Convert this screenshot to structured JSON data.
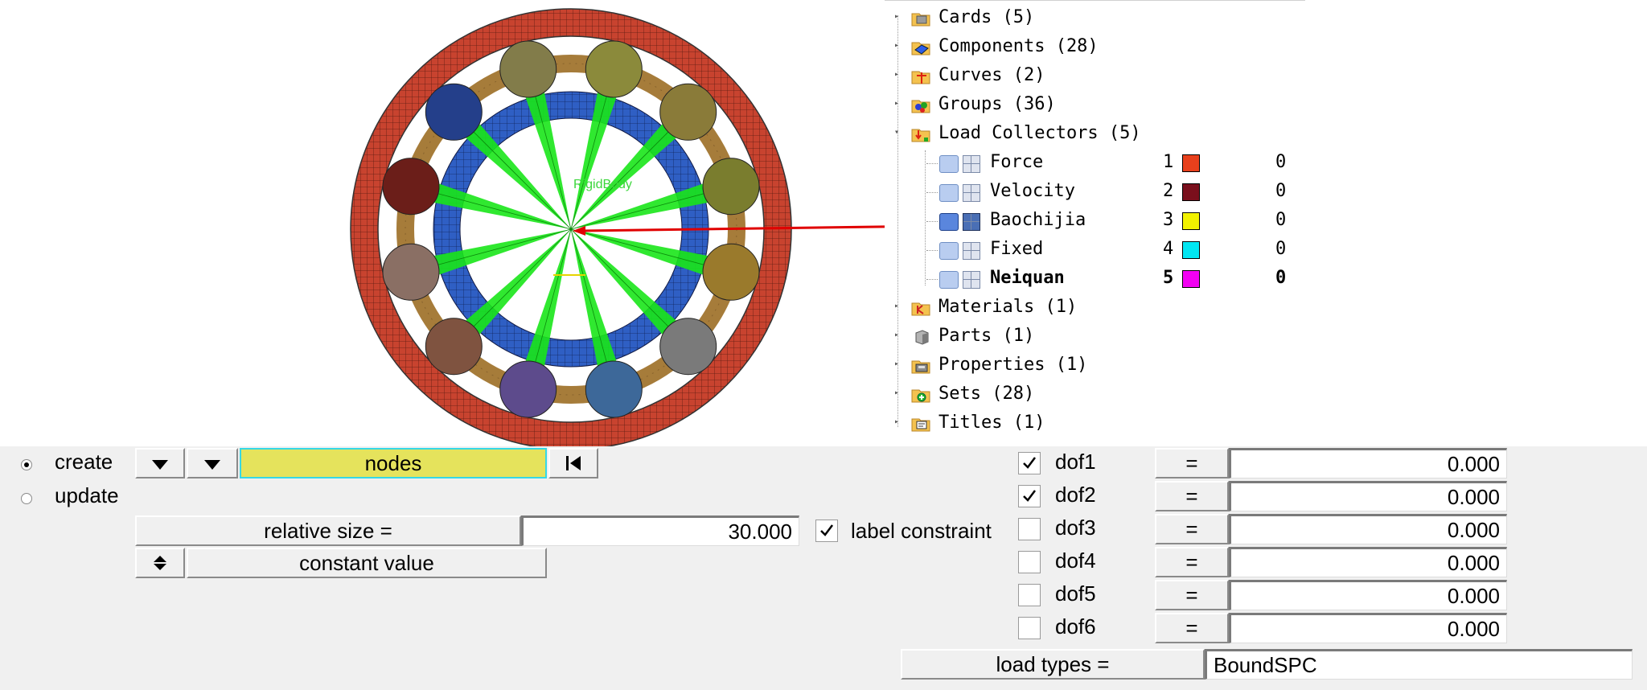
{
  "model_view": {
    "body_label": "RigidBody",
    "colors": {
      "outer_ring": "#c8432f",
      "cage_ring": "#a67c3a",
      "inner_ring": "#2f5fc4",
      "spokes": "#19e619",
      "arrow": "#e00000"
    },
    "balls": [
      "#8b8a3b",
      "#8a7b39",
      "#7a7d2e",
      "#9a7a2c",
      "#7a7a7a",
      "#3d6899",
      "#5d4b8c",
      "#7f5340",
      "#8a6f64",
      "#6b1e19",
      "#243f8a",
      "#827c4a"
    ]
  },
  "tree": {
    "items": [
      {
        "label": "Cards (5)",
        "icon": "cards-icon",
        "expanded": false
      },
      {
        "label": "Components (28)",
        "icon": "components-icon",
        "expanded": false
      },
      {
        "label": "Curves (2)",
        "icon": "curves-icon",
        "expanded": false
      },
      {
        "label": "Groups (36)",
        "icon": "groups-icon",
        "expanded": false
      },
      {
        "label": "Load Collectors (5)",
        "icon": "load-collectors-icon",
        "expanded": true
      },
      {
        "label": "Materials (1)",
        "icon": "materials-icon",
        "expanded": false
      },
      {
        "label": "Parts (1)",
        "icon": "parts-icon",
        "expanded": false
      },
      {
        "label": "Properties (1)",
        "icon": "properties-icon",
        "expanded": false
      },
      {
        "label": "Sets (28)",
        "icon": "sets-icon",
        "expanded": false
      },
      {
        "label": "Titles (1)",
        "icon": "titles-icon",
        "expanded": false
      }
    ],
    "load_collectors": [
      {
        "name": "Force",
        "id": "1",
        "color": "#e8401c",
        "value": "0",
        "bold": false
      },
      {
        "name": "Velocity",
        "id": "2",
        "color": "#7a0f1c",
        "value": "0",
        "bold": false
      },
      {
        "name": "Baochijia",
        "id": "3",
        "color": "#f2f200",
        "value": "0",
        "bold": false
      },
      {
        "name": "Fixed",
        "id": "4",
        "color": "#00e6f2",
        "value": "0",
        "bold": false
      },
      {
        "name": "Neiquan",
        "id": "5",
        "color": "#f200f2",
        "value": "0",
        "bold": true
      }
    ]
  },
  "panel": {
    "create_label": "create",
    "update_label": "update",
    "nodes_label": "nodes",
    "relative_size_label": "relative size =",
    "relative_size_value": "30.000",
    "label_constraint": "label constraint",
    "constant_value_label": "constant value",
    "load_types_label": "load types =",
    "load_types_value": "BoundSPC",
    "equals": "=",
    "dofs": [
      {
        "label": "dof1",
        "checked": true,
        "value": "0.000"
      },
      {
        "label": "dof2",
        "checked": true,
        "value": "0.000"
      },
      {
        "label": "dof3",
        "checked": false,
        "value": "0.000"
      },
      {
        "label": "dof4",
        "checked": false,
        "value": "0.000"
      },
      {
        "label": "dof5",
        "checked": false,
        "value": "0.000"
      },
      {
        "label": "dof6",
        "checked": false,
        "value": "0.000"
      }
    ]
  }
}
